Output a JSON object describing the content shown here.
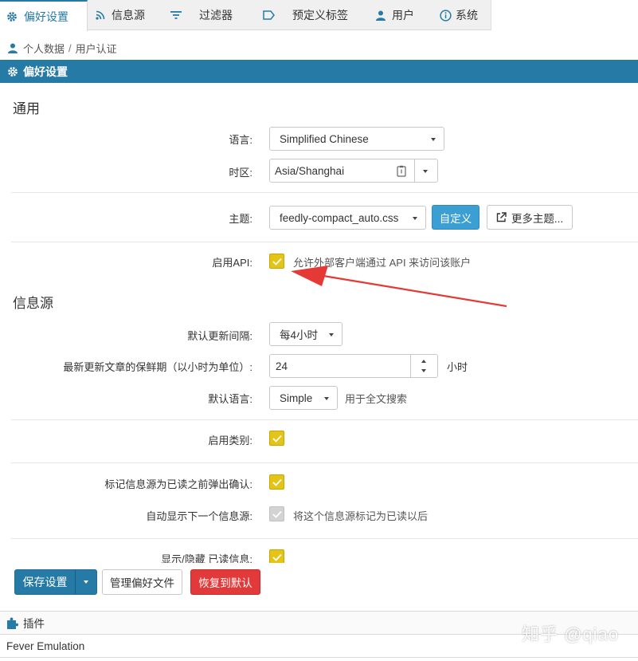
{
  "tabs": [
    {
      "label": "偏好设置",
      "icon": "gear-icon"
    },
    {
      "label": "信息源",
      "icon": "rss-icon"
    },
    {
      "label": "过滤器",
      "icon": "filter-icon"
    },
    {
      "label": "预定义标签",
      "icon": "tag-icon"
    },
    {
      "label": "用户",
      "icon": "user-icon"
    },
    {
      "label": "系统",
      "icon": "info-icon"
    }
  ],
  "breadcrumb": {
    "items": [
      "个人数据",
      "用户认证"
    ],
    "separator": "/"
  },
  "panel_title": "偏好设置",
  "general": {
    "heading": "通用",
    "language_label": "语言:",
    "language_value": "Simplified Chinese",
    "timezone_label": "时区:",
    "timezone_value": "Asia/Shanghai",
    "theme_label": "主题:",
    "theme_value": "feedly-compact_auto.css",
    "customize_button": "自定义",
    "more_themes_button": "更多主题...",
    "api_label": "启用API:",
    "api_hint": "允许外部客户端通过 API 来访问该账户",
    "api_checked": true
  },
  "feeds": {
    "heading": "信息源",
    "update_interval_label": "默认更新间隔:",
    "update_interval_value": "每4小时",
    "freshness_label": "最新更新文章的保鲜期（以小时为单位）:",
    "freshness_value": "24",
    "freshness_unit": "小时",
    "default_lang_label": "默认语言:",
    "default_lang_value": "Simple",
    "default_lang_hint": "用于全文搜索",
    "categories_label": "启用类别:",
    "categories_checked": true,
    "confirm_mark_read_label": "标记信息源为已读之前弹出确认:",
    "confirm_mark_read_checked": true,
    "auto_next_label": "自动显示下一个信息源:",
    "auto_next_hint": "将这个信息源标记为已读以后",
    "auto_next_checked": true,
    "auto_next_disabled": true,
    "show_hide_read_label": "显示/隐藏 已读信息:",
    "show_hide_read_checked": true
  },
  "toolbar": {
    "save_label": "保存设置",
    "manage_label": "管理偏好文件",
    "reset_label": "恢复到默认"
  },
  "plugins_title": "插件",
  "plugin_item": "Fever Emulation",
  "watermark": "知乎 @qiao",
  "colors": {
    "accent": "#257aa6",
    "danger": "#e23a3a",
    "checkbox": "#e5c418",
    "annotation_arrow": "#e53935"
  }
}
